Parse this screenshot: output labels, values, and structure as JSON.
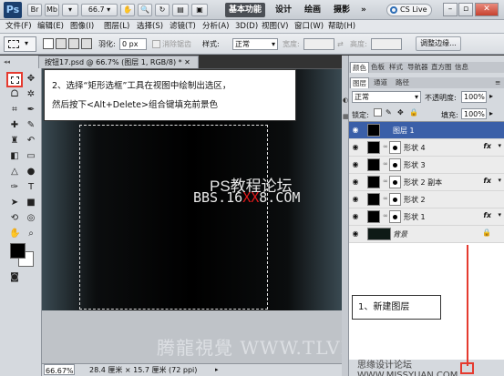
{
  "titlebar": {
    "logo": "Ps",
    "zoom": "66.7",
    "workspaces": [
      "基本功能",
      "设计",
      "绘画",
      "摄影"
    ],
    "more": "»",
    "cslive": "CS Live",
    "win_buttons": [
      "–",
      "▫",
      "✕"
    ]
  },
  "menu": [
    "文件(F)",
    "编辑(E)",
    "图像(I)",
    "图层(L)",
    "选择(S)",
    "滤镜(T)",
    "分析(A)",
    "3D(D)",
    "视图(V)",
    "窗口(W)",
    "帮助(H)"
  ],
  "options": {
    "feather_label": "羽化:",
    "feather_value": "0 px",
    "antialias": "消除锯齿",
    "style_label": "样式:",
    "style_value": "正常",
    "width_label": "宽度:",
    "height_label": "高度:",
    "refine_button": "调整边缘..."
  },
  "document": {
    "tab_title": "按钮17.psd @ 66.7% (图层 1, RGB/8) * ✕",
    "watermark_line1": "PS教程论坛",
    "watermark_line2_a": "BBS.16",
    "watermark_line2_b": "XX",
    "watermark_line2_c": "8.COM"
  },
  "callout": {
    "line1": "2、选择“矩形选框”工具在视图中绘制出选区，",
    "line2": "然后按下<Alt+Delete>组合键填充前景色"
  },
  "status": {
    "zoom": "66.67%",
    "docsize": "28.4 厘米 × 15.7 厘米 (72 ppi)"
  },
  "panels": {
    "top_tabs": [
      "颜色",
      "色板",
      "样式",
      "导航器",
      "直方图",
      "信息"
    ],
    "layer_tabs": [
      "图层",
      "通道",
      "路径"
    ],
    "blend_mode": "正常",
    "opacity_label": "不透明度:",
    "opacity_value": "100%",
    "lock_label": "锁定:",
    "fill_label": "填充:",
    "fill_value": "100%"
  },
  "layers": [
    {
      "name": "图层 1",
      "selected": true,
      "fx": false
    },
    {
      "name": "形状 4",
      "selected": false,
      "fx": true
    },
    {
      "name": "形状 3",
      "selected": false,
      "fx": false
    },
    {
      "name": "形状 2 副本",
      "selected": false,
      "fx": true
    },
    {
      "name": "形状 2",
      "selected": false,
      "fx": false
    },
    {
      "name": "形状 1",
      "selected": false,
      "fx": true
    },
    {
      "name": "背景",
      "selected": false,
      "fx": false
    }
  ],
  "callout2": "1、新建图层",
  "footer": {
    "watermark": "腾龍視覺 WWW.TLVI.NET",
    "site": "思缘设计论坛 WWW.MISSYUAN.COM"
  },
  "colors": {
    "accent_red": "#e53a2f",
    "selected_layer": "#3a5fa8"
  }
}
